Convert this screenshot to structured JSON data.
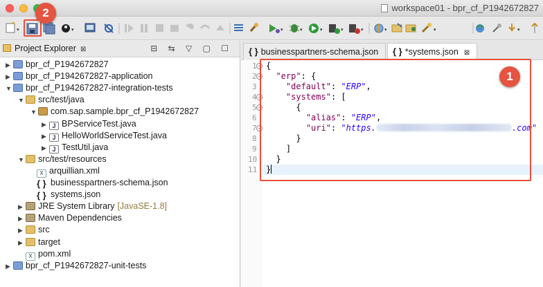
{
  "window": {
    "title": "workspace01 - bpr_cf_P1942672827"
  },
  "annotations": {
    "badge_editor": "1",
    "badge_save": "2"
  },
  "toolbar": {
    "icons": [
      "new-icon",
      "save-icon",
      "save-all-icon",
      "profile-icon",
      "terminal-icon",
      "skip-breakpoints-icon",
      "resume-icon",
      "suspend-icon",
      "stop-icon",
      "disconnect-icon",
      "step-into-icon",
      "step-over-icon",
      "step-return-icon",
      "tasks-icon",
      "build-icon",
      "debug-icon",
      "run-icon",
      "run-server-icon",
      "stop-server-icon",
      "new-java-icon",
      "open-type-icon",
      "search-icon",
      "globe-icon",
      "pin-icon",
      "next-annotation-icon",
      "back-icon"
    ]
  },
  "explorer": {
    "title": "Project Explorer",
    "close_glyph": "⊠",
    "tools": "⊟ ⇆ ▽ ▢ ☐",
    "items": [
      {
        "label": "bpr_cf_P1942672827",
        "twisty": "▶",
        "icon": "project-icon"
      },
      {
        "label": "bpr_cf_P1942672827-application",
        "twisty": "▶",
        "icon": "project-icon"
      },
      {
        "label": "bpr_cf_P1942672827-integration-tests",
        "twisty": "▼",
        "icon": "project-icon"
      },
      {
        "label": "src/test/java",
        "twisty": "▼",
        "icon": "source-folder-icon"
      },
      {
        "label": "com.sap.sample.bpr_cf_P1942672827",
        "twisty": "▼",
        "icon": "package-icon"
      },
      {
        "label": "BPServiceTest.java",
        "twisty": "▶",
        "icon": "java-file-icon"
      },
      {
        "label": "HelloWorldServiceTest.java",
        "twisty": "▶",
        "icon": "java-file-icon"
      },
      {
        "label": "TestUtil.java",
        "twisty": "▶",
        "icon": "java-file-icon"
      },
      {
        "label": "src/test/resources",
        "twisty": "▼",
        "icon": "source-folder-icon"
      },
      {
        "label": "arquillian.xml",
        "twisty": "",
        "icon": "xml-file-icon"
      },
      {
        "label": "businesspartners-schema.json",
        "twisty": "",
        "icon": "json-file-icon"
      },
      {
        "label": "systems.json",
        "twisty": "",
        "icon": "json-file-icon"
      },
      {
        "label": "JRE System Library",
        "suffix": "[JavaSE-1.8]",
        "twisty": "▶",
        "icon": "library-icon"
      },
      {
        "label": "Maven Dependencies",
        "twisty": "▶",
        "icon": "library-icon"
      },
      {
        "label": "src",
        "twisty": "▶",
        "icon": "folder-icon"
      },
      {
        "label": "target",
        "twisty": "▶",
        "icon": "folder-icon"
      },
      {
        "label": "pom.xml",
        "twisty": "",
        "icon": "xml-file-icon"
      },
      {
        "label": "bpr_cf_P1942672827-unit-tests",
        "twisty": "▶",
        "icon": "project-icon"
      }
    ]
  },
  "editor": {
    "tabs": [
      {
        "label": "businesspartners-schema.json",
        "active": false
      },
      {
        "label": "*systems.json",
        "active": true
      }
    ],
    "tab_close_glyph": "⊠",
    "brace_glyph": "{ }",
    "line_numbers": [
      "1",
      "2",
      "3",
      "4",
      "5",
      "6",
      "7",
      "8",
      "9",
      "10",
      "11"
    ],
    "lines": {
      "l1": "{",
      "l2_key": "\"erp\"",
      "l2_rest": ": {",
      "l3_key": "\"default\"",
      "l3_sep": ": ",
      "l3_val": "\"ERP\"",
      "l3_end": ",",
      "l4_key": "\"systems\"",
      "l4_rest": ": [",
      "l5": "{",
      "l6_key": "\"alias\"",
      "l6_sep": ": ",
      "l6_val": "\"ERP\"",
      "l6_end": ",",
      "l7_key": "\"uri\"",
      "l7_sep": ": ",
      "l7_val_start": "\"https.",
      "l7_val_end": ".com\"",
      "l8": "}",
      "l9": "]",
      "l10": "}",
      "l11": "}"
    }
  },
  "colors": {
    "annotation_red": "#e45440",
    "json_key": "#7f0055",
    "json_string": "#2a00ff"
  }
}
